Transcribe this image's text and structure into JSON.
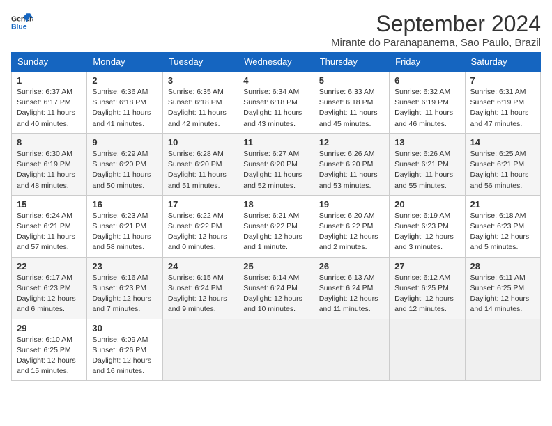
{
  "logo": {
    "line1": "General",
    "line2": "Blue"
  },
  "title": "September 2024",
  "location": "Mirante do Paranapanema, Sao Paulo, Brazil",
  "days_of_week": [
    "Sunday",
    "Monday",
    "Tuesday",
    "Wednesday",
    "Thursday",
    "Friday",
    "Saturday"
  ],
  "weeks": [
    [
      {
        "day": 1,
        "info": "Sunrise: 6:37 AM\nSunset: 6:17 PM\nDaylight: 11 hours\nand 40 minutes."
      },
      {
        "day": 2,
        "info": "Sunrise: 6:36 AM\nSunset: 6:18 PM\nDaylight: 11 hours\nand 41 minutes."
      },
      {
        "day": 3,
        "info": "Sunrise: 6:35 AM\nSunset: 6:18 PM\nDaylight: 11 hours\nand 42 minutes."
      },
      {
        "day": 4,
        "info": "Sunrise: 6:34 AM\nSunset: 6:18 PM\nDaylight: 11 hours\nand 43 minutes."
      },
      {
        "day": 5,
        "info": "Sunrise: 6:33 AM\nSunset: 6:18 PM\nDaylight: 11 hours\nand 45 minutes."
      },
      {
        "day": 6,
        "info": "Sunrise: 6:32 AM\nSunset: 6:19 PM\nDaylight: 11 hours\nand 46 minutes."
      },
      {
        "day": 7,
        "info": "Sunrise: 6:31 AM\nSunset: 6:19 PM\nDaylight: 11 hours\nand 47 minutes."
      }
    ],
    [
      {
        "day": 8,
        "info": "Sunrise: 6:30 AM\nSunset: 6:19 PM\nDaylight: 11 hours\nand 48 minutes."
      },
      {
        "day": 9,
        "info": "Sunrise: 6:29 AM\nSunset: 6:20 PM\nDaylight: 11 hours\nand 50 minutes."
      },
      {
        "day": 10,
        "info": "Sunrise: 6:28 AM\nSunset: 6:20 PM\nDaylight: 11 hours\nand 51 minutes."
      },
      {
        "day": 11,
        "info": "Sunrise: 6:27 AM\nSunset: 6:20 PM\nDaylight: 11 hours\nand 52 minutes."
      },
      {
        "day": 12,
        "info": "Sunrise: 6:26 AM\nSunset: 6:20 PM\nDaylight: 11 hours\nand 53 minutes."
      },
      {
        "day": 13,
        "info": "Sunrise: 6:26 AM\nSunset: 6:21 PM\nDaylight: 11 hours\nand 55 minutes."
      },
      {
        "day": 14,
        "info": "Sunrise: 6:25 AM\nSunset: 6:21 PM\nDaylight: 11 hours\nand 56 minutes."
      }
    ],
    [
      {
        "day": 15,
        "info": "Sunrise: 6:24 AM\nSunset: 6:21 PM\nDaylight: 11 hours\nand 57 minutes."
      },
      {
        "day": 16,
        "info": "Sunrise: 6:23 AM\nSunset: 6:21 PM\nDaylight: 11 hours\nand 58 minutes."
      },
      {
        "day": 17,
        "info": "Sunrise: 6:22 AM\nSunset: 6:22 PM\nDaylight: 12 hours\nand 0 minutes."
      },
      {
        "day": 18,
        "info": "Sunrise: 6:21 AM\nSunset: 6:22 PM\nDaylight: 12 hours\nand 1 minute."
      },
      {
        "day": 19,
        "info": "Sunrise: 6:20 AM\nSunset: 6:22 PM\nDaylight: 12 hours\nand 2 minutes."
      },
      {
        "day": 20,
        "info": "Sunrise: 6:19 AM\nSunset: 6:23 PM\nDaylight: 12 hours\nand 3 minutes."
      },
      {
        "day": 21,
        "info": "Sunrise: 6:18 AM\nSunset: 6:23 PM\nDaylight: 12 hours\nand 5 minutes."
      }
    ],
    [
      {
        "day": 22,
        "info": "Sunrise: 6:17 AM\nSunset: 6:23 PM\nDaylight: 12 hours\nand 6 minutes."
      },
      {
        "day": 23,
        "info": "Sunrise: 6:16 AM\nSunset: 6:23 PM\nDaylight: 12 hours\nand 7 minutes."
      },
      {
        "day": 24,
        "info": "Sunrise: 6:15 AM\nSunset: 6:24 PM\nDaylight: 12 hours\nand 9 minutes."
      },
      {
        "day": 25,
        "info": "Sunrise: 6:14 AM\nSunset: 6:24 PM\nDaylight: 12 hours\nand 10 minutes."
      },
      {
        "day": 26,
        "info": "Sunrise: 6:13 AM\nSunset: 6:24 PM\nDaylight: 12 hours\nand 11 minutes."
      },
      {
        "day": 27,
        "info": "Sunrise: 6:12 AM\nSunset: 6:25 PM\nDaylight: 12 hours\nand 12 minutes."
      },
      {
        "day": 28,
        "info": "Sunrise: 6:11 AM\nSunset: 6:25 PM\nDaylight: 12 hours\nand 14 minutes."
      }
    ],
    [
      {
        "day": 29,
        "info": "Sunrise: 6:10 AM\nSunset: 6:25 PM\nDaylight: 12 hours\nand 15 minutes."
      },
      {
        "day": 30,
        "info": "Sunrise: 6:09 AM\nSunset: 6:26 PM\nDaylight: 12 hours\nand 16 minutes."
      },
      null,
      null,
      null,
      null,
      null
    ]
  ]
}
